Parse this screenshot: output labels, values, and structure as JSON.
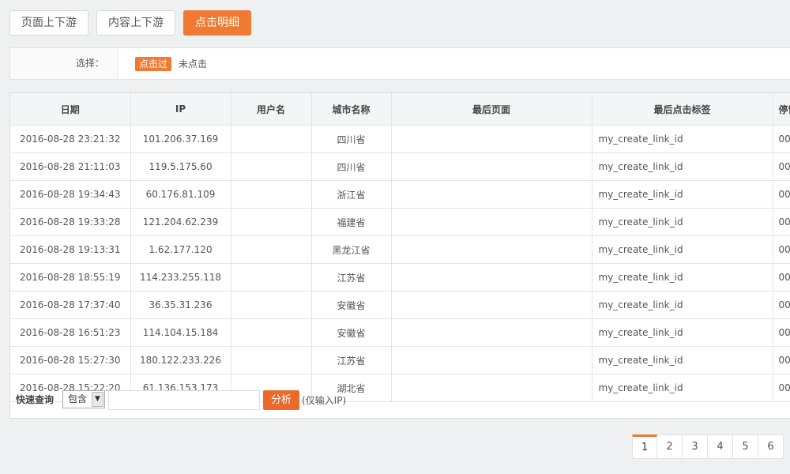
{
  "tabs": [
    {
      "label": "页面上下游",
      "active": false
    },
    {
      "label": "内容上下游",
      "active": false
    },
    {
      "label": "点击明细",
      "active": true
    }
  ],
  "filter": {
    "label": "选择：",
    "options": [
      {
        "label": "点击过",
        "active": true
      },
      {
        "label": "未点击",
        "active": false
      }
    ]
  },
  "table": {
    "columns": [
      "日期",
      "IP",
      "用户名",
      "城市名称",
      "最后页面",
      "最后点击标签",
      "停留"
    ],
    "rows": [
      [
        "2016-08-28 23:21:32",
        "101.206.37.169",
        "",
        "四川省",
        "",
        "my_create_link_id",
        "00"
      ],
      [
        "2016-08-28 21:11:03",
        "119.5.175.60",
        "",
        "四川省",
        "",
        "my_create_link_id",
        "00"
      ],
      [
        "2016-08-28 19:34:43",
        "60.176.81.109",
        "",
        "浙江省",
        "",
        "my_create_link_id",
        "00"
      ],
      [
        "2016-08-28 19:33:28",
        "121.204.62.239",
        "",
        "福建省",
        "",
        "my_create_link_id",
        "00"
      ],
      [
        "2016-08-28 19:13:31",
        "1.62.177.120",
        "",
        "黑龙江省",
        "",
        "my_create_link_id",
        "00"
      ],
      [
        "2016-08-28 18:55:19",
        "114.233.255.118",
        "",
        "江苏省",
        "",
        "my_create_link_id",
        "00"
      ],
      [
        "2016-08-28 17:37:40",
        "36.35.31.236",
        "",
        "安徽省",
        "",
        "my_create_link_id",
        "00"
      ],
      [
        "2016-08-28 16:51:23",
        "114.104.15.184",
        "",
        "安徽省",
        "",
        "my_create_link_id",
        "00"
      ],
      [
        "2016-08-28 15:27:30",
        "180.122.233.226",
        "",
        "江苏省",
        "",
        "my_create_link_id",
        "00"
      ],
      [
        "2016-08-28 15:22:20",
        "61.136.153.173",
        "",
        "湖北省",
        "",
        "my_create_link_id",
        "00"
      ]
    ]
  },
  "quick_search": {
    "label": "快速查询",
    "select_value": "包含",
    "caret_icon": "chevron-down-icon",
    "input_value": "",
    "button_label": "分析",
    "note": "(仅输入IP)"
  },
  "pagination": {
    "pages": [
      "1",
      "2",
      "3",
      "4",
      "5",
      "6"
    ],
    "current": "1"
  },
  "colors": {
    "accent": "#ef7a32",
    "button": "#ea6a2c",
    "background": "#eef0f1"
  }
}
